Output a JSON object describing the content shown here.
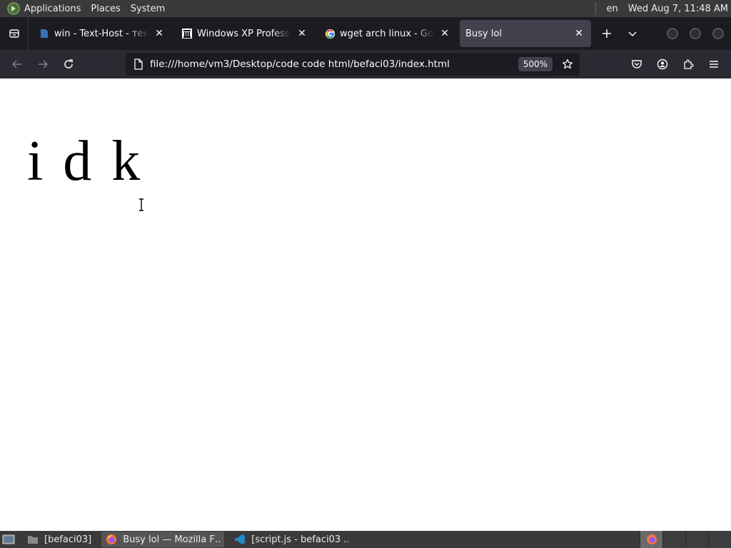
{
  "system_panel": {
    "menu": [
      "Applications",
      "Places",
      "System"
    ],
    "language": "en",
    "clock": "Wed Aug  7, 11:48 AM"
  },
  "tabs": [
    {
      "title": "win - Text-Host - текс",
      "icon": "page-blue-icon",
      "active": false
    },
    {
      "title": "Windows XP Professio",
      "icon": "archive-museum-icon",
      "active": false
    },
    {
      "title": "wget arch linux - Goog",
      "icon": "google-g-icon",
      "active": false
    },
    {
      "title": "Busy lol",
      "icon": "none",
      "active": true
    }
  ],
  "navbar": {
    "url": "file:///home/vm3/Desktop/code code html/befaci03/index.html",
    "zoom": "500%"
  },
  "page": {
    "text": "i d k"
  },
  "taskbar": {
    "tasks": [
      {
        "label": "[befaci03]",
        "icon": "folder-icon",
        "active": false
      },
      {
        "label": "Busy lol — Mozilla F…",
        "icon": "firefox-icon",
        "active": true
      },
      {
        "label": "[script.js - befaci03 …",
        "icon": "vscode-icon",
        "active": false
      }
    ]
  },
  "colors": {
    "panel_bg": "#3a3a3a",
    "tabstrip_bg": "#1c1b22",
    "active_tab_bg": "#42414d",
    "toolbar_bg": "#2b2a33",
    "urlbar_bg": "#1c1b22"
  }
}
